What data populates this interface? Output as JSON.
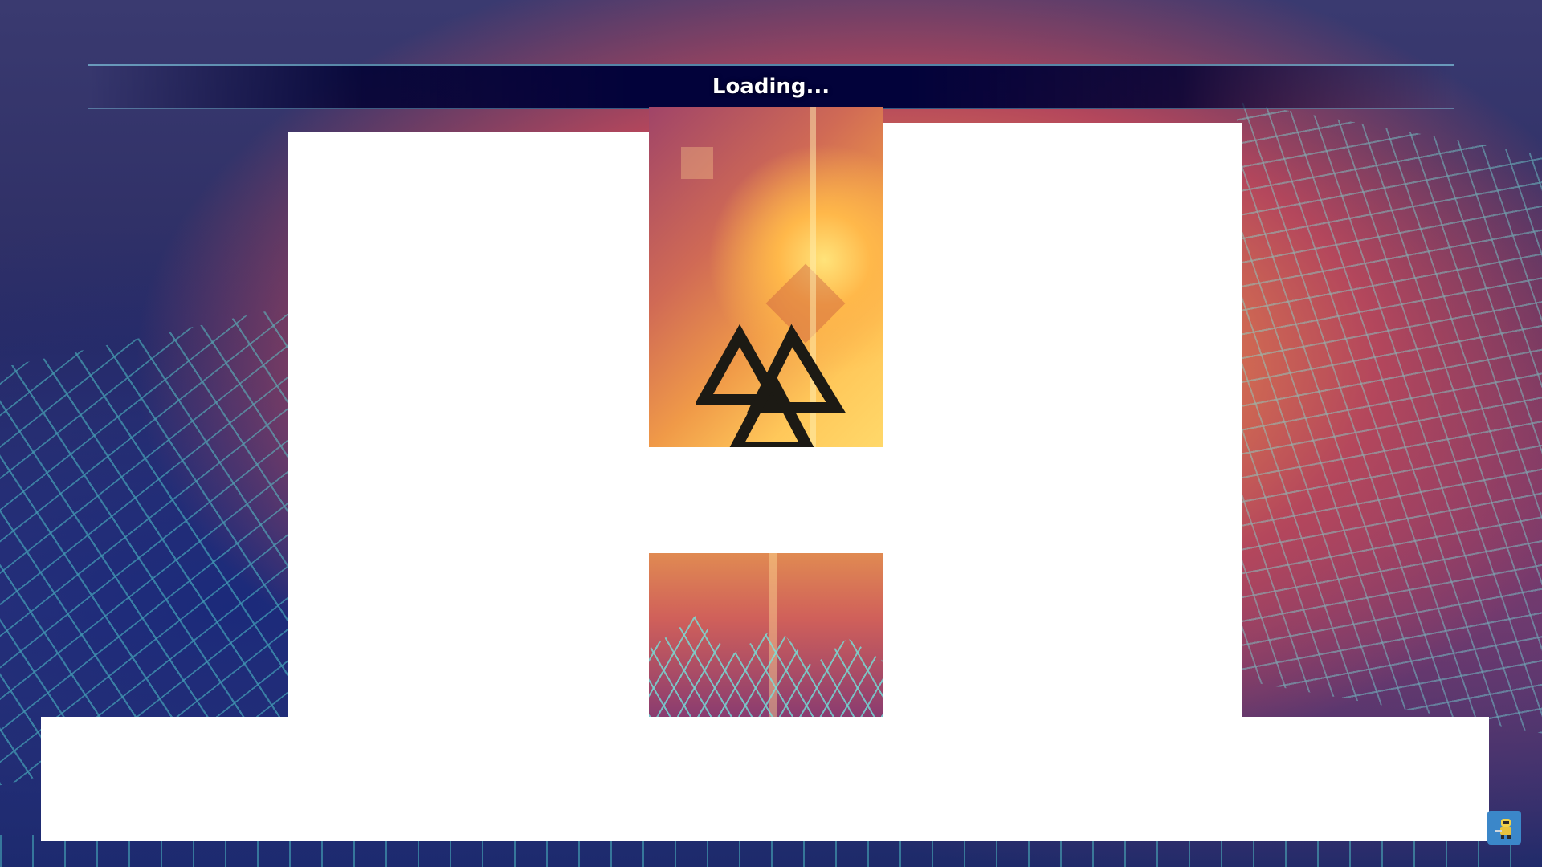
{
  "loading": {
    "text": "Loading..."
  },
  "colors": {
    "loading_bar_bg": "#02023a",
    "accent_cyan": "#5ae6dc",
    "panel": "#ffffff",
    "mascot_bg": "#3b87c9"
  },
  "icons": {
    "logo": "triangle-knot-logo-icon",
    "corner": "mascot-icon"
  }
}
